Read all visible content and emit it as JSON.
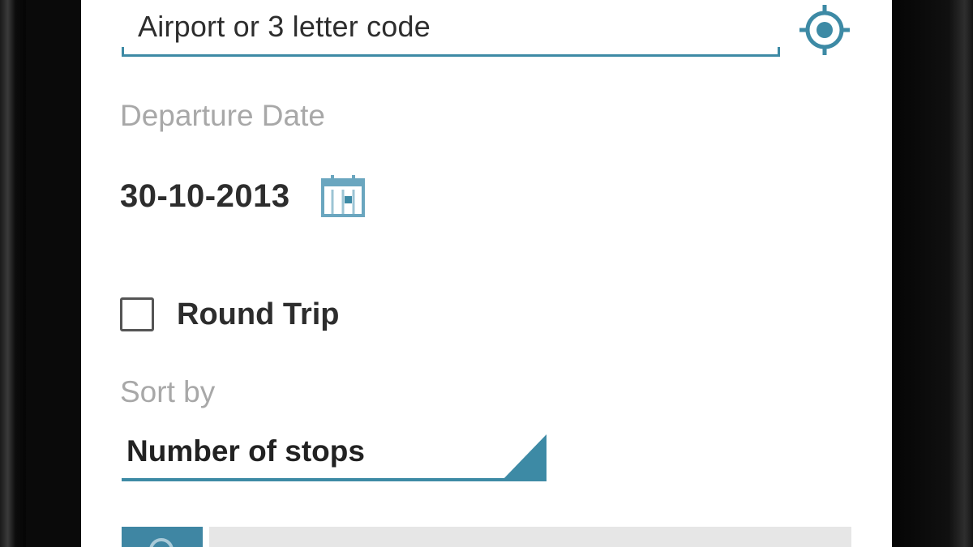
{
  "form": {
    "airport_input": {
      "placeholder": "Airport or 3 letter code"
    },
    "departure_date": {
      "label": "Departure Date",
      "value": "30-10-2013"
    },
    "round_trip": {
      "label": "Round Trip",
      "checked": false
    },
    "sort_by": {
      "label": "Sort by",
      "selected": "Number of stops"
    }
  },
  "icons": {
    "locate": "my-location-icon",
    "calendar": "calendar-icon",
    "search": "search-icon"
  },
  "colors": {
    "accent": "#3d8aa5",
    "label_gray": "#a8a8a8",
    "text_dark": "#2d2d2d"
  }
}
